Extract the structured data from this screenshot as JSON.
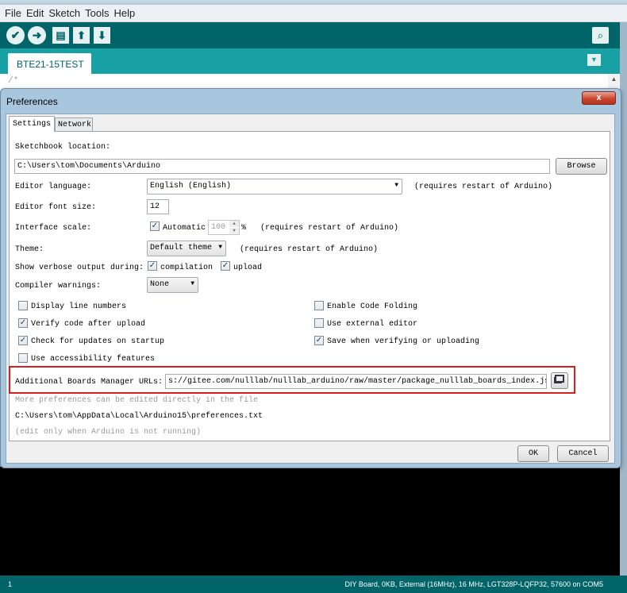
{
  "ide": {
    "menu": [
      "File",
      "Edit",
      "Sketch",
      "Tools",
      "Help"
    ],
    "toolbar": {
      "verify_icon": "checkmark-icon",
      "upload_icon": "right-arrow-icon",
      "new_icon": "new-file-icon",
      "open_icon": "up-arrow-icon",
      "save_icon": "down-arrow-icon",
      "serial_icon": "magnifier-icon"
    },
    "tab_name": "BTE21-15TEST",
    "editor_first_line": "/*",
    "status": {
      "line_number": "1",
      "board": "DIY Board, 0KB, External (16MHz), 16 MHz, LGT328P-LQFP32, 57600 on COM5"
    },
    "colors": {
      "toolbar": "#006468",
      "tabbar": "#17a1a5",
      "console": "#000000"
    }
  },
  "dialog": {
    "title": "Preferences",
    "close_label": "x",
    "tabs": [
      "Settings",
      "Network"
    ],
    "sketchbook_label": "Sketchbook location:",
    "sketchbook_value": "C:\\Users\\tom\\Documents\\Arduino",
    "browse_label": "Browse",
    "language_label": "Editor language:",
    "language_value": "English (English)",
    "restart_note": "(requires restart of Arduino)",
    "font_size_label": "Editor font size:",
    "font_size_value": "12",
    "scale_label": "Interface scale:",
    "scale_auto_label": "Automatic",
    "scale_value": "100",
    "scale_unit": "%",
    "theme_label": "Theme:",
    "theme_value": "Default theme",
    "verbose_label": "Show verbose output during:",
    "verbose_compilation": "compilation",
    "verbose_upload": "upload",
    "warnings_label": "Compiler warnings:",
    "warnings_value": "None",
    "options_left": [
      {
        "label": "Display line numbers",
        "checked": false
      },
      {
        "label": "Verify code after upload",
        "checked": true
      },
      {
        "label": "Check for updates on startup",
        "checked": true
      },
      {
        "label": "Use accessibility features",
        "checked": false
      }
    ],
    "options_right": [
      {
        "label": "Enable Code Folding",
        "checked": false
      },
      {
        "label": "Use external editor",
        "checked": false
      },
      {
        "label": "Save when verifying or uploading",
        "checked": true
      }
    ],
    "urls_label": "Additional Boards Manager URLs:",
    "urls_value": "s://gitee.com/nulllab/nulllab_arduino/raw/master/package_nulllab_boards_index.json",
    "urls_button_icon": "window-stack-icon",
    "more_prefs_note": "More preferences can be edited directly in the file",
    "prefs_path": "C:\\Users\\tom\\AppData\\Local\\Arduino15\\preferences.txt",
    "edit_note": "(edit only when Arduino is not running)",
    "ok_label": "OK",
    "cancel_label": "Cancel",
    "highlight_color": "#d81e1e"
  }
}
